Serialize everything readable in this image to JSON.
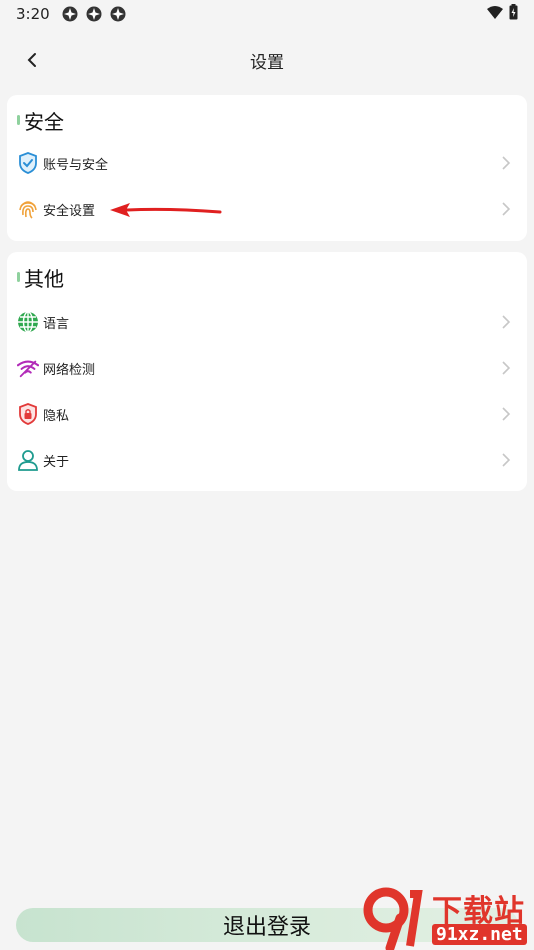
{
  "status_bar": {
    "time": "3:20"
  },
  "nav": {
    "title": "设置"
  },
  "sections": [
    {
      "title": "安全",
      "items": [
        {
          "label": "账号与安全",
          "icon": "shield-check-icon"
        },
        {
          "label": "安全设置",
          "icon": "fingerprint-icon"
        }
      ]
    },
    {
      "title": "其他",
      "items": [
        {
          "label": "语言",
          "icon": "globe-icon"
        },
        {
          "label": "网络检测",
          "icon": "wifi-icon"
        },
        {
          "label": "隐私",
          "icon": "lock-shield-icon"
        },
        {
          "label": "关于",
          "icon": "user-icon"
        }
      ]
    }
  ],
  "logout": {
    "label": "退出登录"
  },
  "watermark": {
    "text": "下载站",
    "domain": "91xz.net"
  },
  "colors": {
    "accent_green": "#8fd19e",
    "arrow_red": "#e02020",
    "watermark_red": "#e0352b"
  }
}
